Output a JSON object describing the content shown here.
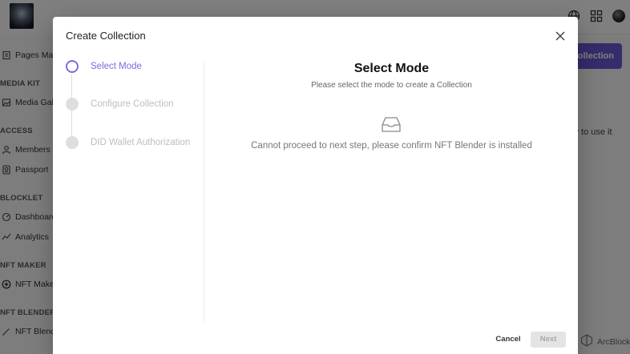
{
  "background": {
    "sidebar": {
      "items": [
        {
          "type": "item",
          "label": "Pages Mak",
          "icon": "page-icon"
        },
        {
          "type": "section",
          "label": "MEDIA KIT"
        },
        {
          "type": "item",
          "label": "Media Gall",
          "icon": "image-icon"
        },
        {
          "type": "section",
          "label": "ACCESS"
        },
        {
          "type": "item",
          "label": "Members",
          "icon": "person-icon"
        },
        {
          "type": "item",
          "label": "Passport",
          "icon": "passport-icon"
        },
        {
          "type": "section",
          "label": "BLOCKLET"
        },
        {
          "type": "item",
          "label": "Dashboard",
          "icon": "dashboard-icon"
        },
        {
          "type": "item",
          "label": "Analytics",
          "icon": "chart-line-icon"
        },
        {
          "type": "section",
          "label": "NFT MAKER"
        },
        {
          "type": "item",
          "label": "NFT Make",
          "icon": "plus-circle-icon"
        },
        {
          "type": "section",
          "label": "NFT BLENDER"
        },
        {
          "type": "item",
          "label": "NFT Blend",
          "icon": "pencil-icon"
        }
      ]
    },
    "primary_button_label": "Collection",
    "hint_text": "w to use it",
    "footer_brand": "ArcBlock"
  },
  "modal": {
    "title": "Create Collection",
    "steps": [
      {
        "label": "Select Mode",
        "active": true
      },
      {
        "label": "Configure Collection",
        "active": false
      },
      {
        "label": "DID Wallet Authorization",
        "active": false
      }
    ],
    "content": {
      "title": "Select Mode",
      "subtitle": "Please select the mode to create a Collection",
      "empty_icon": "inbox-icon",
      "message": "Cannot proceed to next step, please confirm NFT Blender is installed"
    },
    "actions": {
      "cancel_label": "Cancel",
      "next_label": "Next"
    }
  },
  "colors": {
    "accent": "#7d6bdc",
    "primary_button": "#6a58d6",
    "overlay": "rgba(0,0,0,0.5)"
  }
}
